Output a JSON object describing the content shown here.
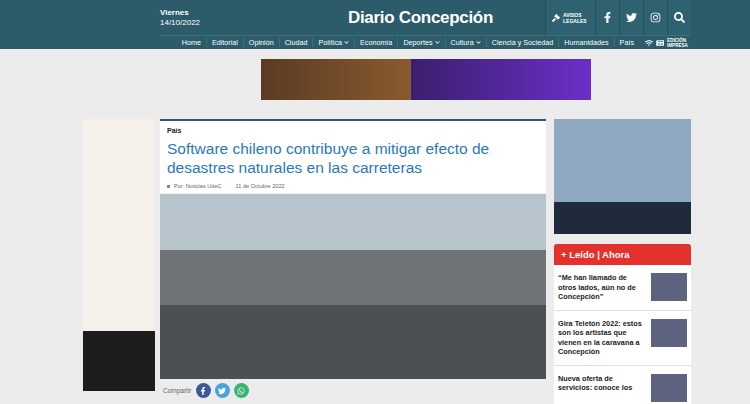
{
  "header": {
    "day": "Viernes",
    "date": "14/10/2022",
    "logo": "Diario Concepción",
    "legal": "AVISOS LEGALES",
    "print_edition": "EDICIÓN IMPRESA"
  },
  "nav": [
    {
      "label": "Home",
      "dropdown": false
    },
    {
      "label": "Editorial",
      "dropdown": false
    },
    {
      "label": "Opinión",
      "dropdown": false
    },
    {
      "label": "Ciudad",
      "dropdown": false
    },
    {
      "label": "Política",
      "dropdown": true
    },
    {
      "label": "Economía",
      "dropdown": false
    },
    {
      "label": "Deportes",
      "dropdown": true
    },
    {
      "label": "Cultura",
      "dropdown": true
    },
    {
      "label": "Ciencia y Sociedad",
      "dropdown": false
    },
    {
      "label": "Humanidades",
      "dropdown": false
    },
    {
      "label": "País",
      "dropdown": false
    }
  ],
  "article": {
    "section": "País",
    "title": "Software chileno contribuye a mitigar efecto de desastres naturales en las carreteras",
    "author": "Por: Noticias UdeC",
    "date": "11 de Octubre 2022",
    "share_label": "Compartir"
  },
  "popular": {
    "title": "+ Leído | Ahora",
    "items": [
      "“Me han llamado de otros lados, aún no de Concepción”",
      "Gira Teletón 2022: estos son los artistas que vienen en la caravana a Concepción",
      "Nueva oferta de servicios: conoce los"
    ]
  }
}
